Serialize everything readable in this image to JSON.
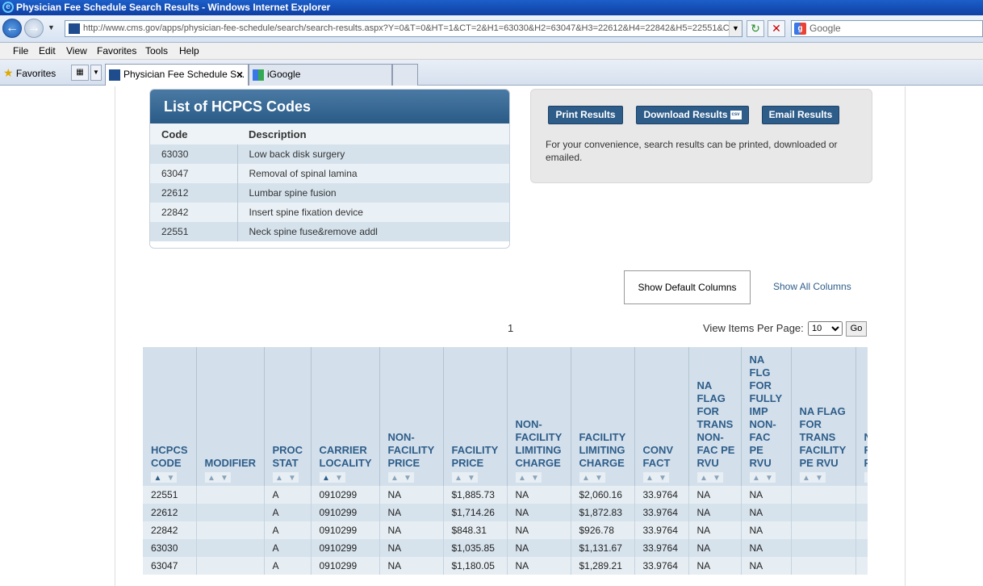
{
  "window": {
    "title": "Physician Fee Schedule Search Results - Windows Internet Explorer"
  },
  "addressbar": {
    "url": "http://www.cms.gov/apps/physician-fee-schedule/search/search-results.aspx?Y=0&T=0&HT=1&CT=2&H1=63030&H2=63047&H3=22612&H4=22842&H5=22551&C",
    "search_placeholder": "Google"
  },
  "menu": {
    "items": [
      "File",
      "Edit",
      "View",
      "Favorites",
      "Tools",
      "Help"
    ]
  },
  "tabs": {
    "favorites_label": "Favorites",
    "active_tab": "Physician Fee Schedule S...",
    "inactive_tab": "iGoogle"
  },
  "codes_panel": {
    "title": "List of HCPCS Codes",
    "headers": [
      "Code",
      "Description"
    ],
    "rows": [
      {
        "code": "63030",
        "desc": "Low back disk surgery"
      },
      {
        "code": "63047",
        "desc": "Removal of spinal lamina"
      },
      {
        "code": "22612",
        "desc": "Lumbar spine fusion"
      },
      {
        "code": "22842",
        "desc": "Insert spine fixation device"
      },
      {
        "code": "22551",
        "desc": "Neck spine fuse&remove addl"
      }
    ]
  },
  "actions": {
    "print_label": "Print Results",
    "download_label": "Download Results",
    "email_label": "Email Results",
    "csv_badge": "csv",
    "note": "For your convenience, search results can be printed, downloaded or emailed."
  },
  "columns_controls": {
    "show_default": "Show Default Columns",
    "show_all": "Show All Columns"
  },
  "pagination": {
    "page": "1",
    "per_page_label": "View Items Per Page:",
    "per_page_value": "10",
    "go_label": "Go"
  },
  "results": {
    "headers": [
      "HCPCS CODE",
      "MODIFIER",
      "PROC STAT",
      "CARRIER LOCALITY",
      "NON-FACILITY PRICE",
      "FACILITY PRICE",
      "NON-FACILITY LIMITING CHARGE",
      "FACILITY LIMITING CHARGE",
      "CONV FACT",
      "NA FLAG FOR TRANS NON-FAC PE RVU",
      "NA FLG FOR FULLY IMP NON-FAC PE RVU",
      "NA FLAG FOR TRANS FACILITY PE RVU",
      "NA F F IM F P R"
    ],
    "rows": [
      [
        "22551",
        "",
        "A",
        "0910299",
        "NA",
        "$1,885.73",
        "NA",
        "$2,060.16",
        "33.9764",
        "NA",
        "NA",
        "",
        ""
      ],
      [
        "22612",
        "",
        "A",
        "0910299",
        "NA",
        "$1,714.26",
        "NA",
        "$1,872.83",
        "33.9764",
        "NA",
        "NA",
        "",
        ""
      ],
      [
        "22842",
        "",
        "A",
        "0910299",
        "NA",
        "$848.31",
        "NA",
        "$926.78",
        "33.9764",
        "NA",
        "NA",
        "",
        ""
      ],
      [
        "63030",
        "",
        "A",
        "0910299",
        "NA",
        "$1,035.85",
        "NA",
        "$1,131.67",
        "33.9764",
        "NA",
        "NA",
        "",
        ""
      ],
      [
        "63047",
        "",
        "A",
        "0910299",
        "NA",
        "$1,180.05",
        "NA",
        "$1,289.21",
        "33.9764",
        "NA",
        "NA",
        "",
        ""
      ]
    ]
  }
}
